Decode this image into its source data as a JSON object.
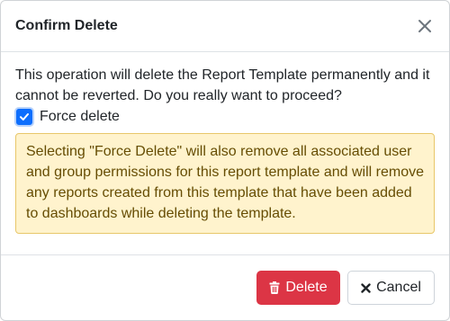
{
  "dialog": {
    "title": "Confirm Delete",
    "close_icon": "close-icon",
    "message": "This operation will delete the Report Template permanently and it cannot be reverted. Do you really want to proceed?",
    "force_delete": {
      "label": "Force delete",
      "checked": true
    },
    "warning": "Selecting \"Force Delete\" will also remove all associated user and group permissions for this report template and will remove any reports created from this template that have been added to dashboards while deleting the template.",
    "buttons": {
      "delete_label": "Delete",
      "delete_icon": "trash-icon",
      "cancel_label": "Cancel",
      "cancel_icon": "x-icon"
    }
  },
  "colors": {
    "danger": "#dc3545",
    "primary": "#0d6efd",
    "warning_bg": "#fff3cd",
    "warning_border": "#e8c76a",
    "warning_text": "#664d03"
  }
}
